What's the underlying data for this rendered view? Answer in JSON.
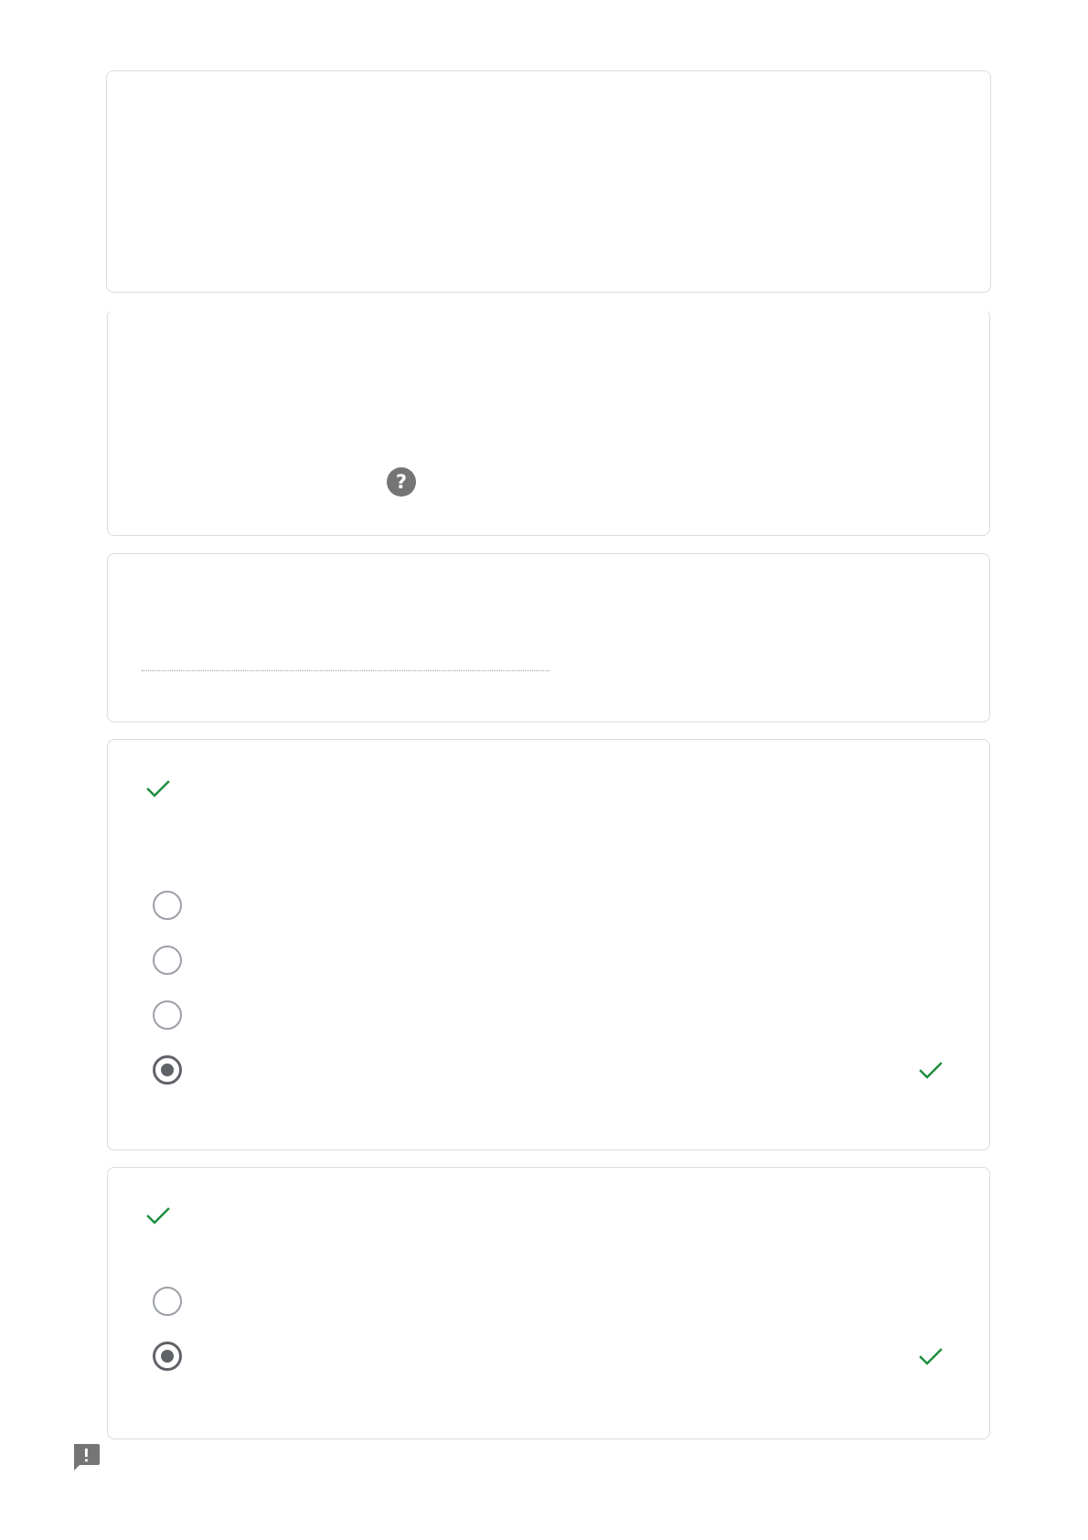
{
  "colors": {
    "card_border": "#dadce0",
    "correct_green": "#1e8e3e",
    "radio_unselected": "#9aa0a6",
    "radio_selected": "#5f6368",
    "help_icon_bg": "#757575",
    "feedback_icon": "#757575"
  },
  "icons": {
    "help": "help-circle-icon",
    "correct": "checkmark-icon",
    "feedback": "report-feedback-icon"
  },
  "help_icon_glyph": "?",
  "cards": [
    {
      "id": "card-1",
      "type": "blank"
    },
    {
      "id": "card-2",
      "type": "help"
    },
    {
      "id": "card-3",
      "type": "short-answer"
    },
    {
      "id": "card-4",
      "type": "multiple-choice",
      "options": [
        {
          "selected": false,
          "correct": false
        },
        {
          "selected": false,
          "correct": false
        },
        {
          "selected": false,
          "correct": false
        },
        {
          "selected": true,
          "correct": true
        }
      ]
    },
    {
      "id": "card-5",
      "type": "multiple-choice",
      "options": [
        {
          "selected": false,
          "correct": false
        },
        {
          "selected": true,
          "correct": true
        }
      ]
    }
  ]
}
